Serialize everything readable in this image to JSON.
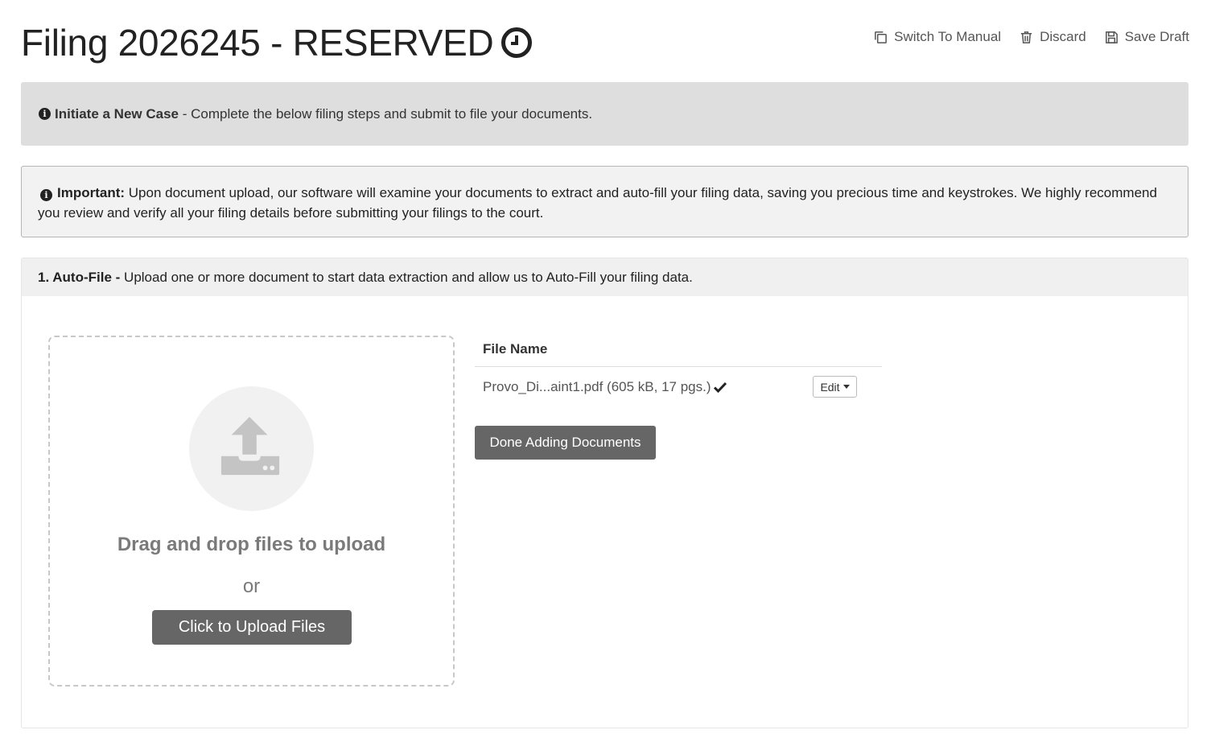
{
  "header": {
    "title": "Filing 2026245 - RESERVED",
    "title_icon": "clock-icon",
    "actions": [
      {
        "label": "Switch To Manual",
        "icon": "copy-icon"
      },
      {
        "label": "Discard",
        "icon": "trash-icon"
      },
      {
        "label": "Save Draft",
        "icon": "floppy-disk-icon"
      }
    ]
  },
  "banner": {
    "icon": "info-icon",
    "title": "Initiate a New Case",
    "text": " - Complete the below filing steps and submit to file your documents."
  },
  "important": {
    "icon": "info-icon",
    "title": "Important:",
    "text": " Upon document upload, our software will examine your documents to extract and auto-fill your filing data, saving you precious time and keystrokes. We highly recommend you review and verify all your filing details before submitting your filings to the court."
  },
  "step1": {
    "title": "1. Auto-File -",
    "text": " Upload one or more document to start data extraction and allow us to Auto-Fill your filing data."
  },
  "dropzone": {
    "icon": "upload-icon",
    "drag_text": "Drag and drop files to upload",
    "or_text": "or",
    "button_label": "Click to Upload Files"
  },
  "files": {
    "column_header": "File Name",
    "rows": [
      {
        "name": "Provo_Di...aint1.pdf (605 kB, 17 pgs.)",
        "status_icon": "check-icon",
        "action_label": "Edit"
      }
    ]
  },
  "done_button_label": "Done Adding Documents",
  "colors": {
    "button_bg": "#666666",
    "banner_bg": "#dedede",
    "box_bg": "#f2f2f2"
  }
}
